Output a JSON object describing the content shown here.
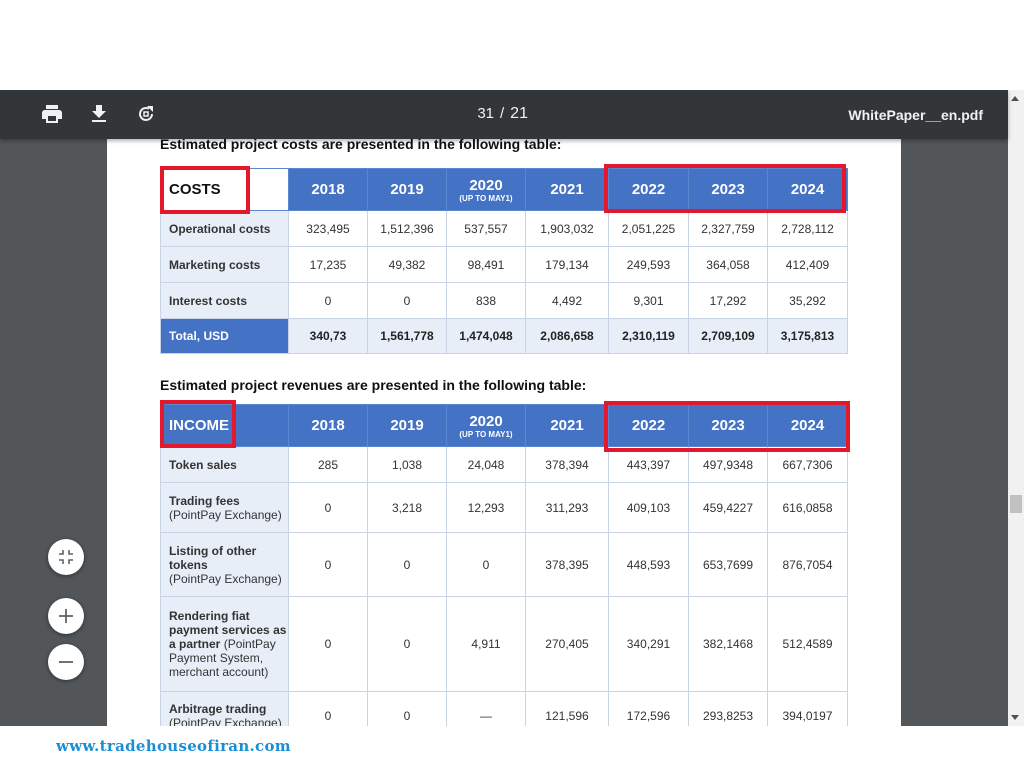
{
  "toolbar": {
    "print_icon": "print-icon",
    "download_icon": "download-icon",
    "rotate_icon": "rotate-icon",
    "page_current": "31",
    "page_separator": "/",
    "page_total": "21",
    "filename": "WhitePaper__en.pdf"
  },
  "costs": {
    "heading": "Estimated project costs are presented in the following table:",
    "header_label": "COSTS",
    "years": [
      "2018",
      "2019",
      "2020",
      "2021",
      "2022",
      "2023",
      "2024"
    ],
    "year_2020_note": "(UP TO MAY1)",
    "rows": [
      {
        "label": "Operational costs",
        "values": [
          "323,495",
          "1,512,396",
          "537,557",
          "1,903,032",
          "2,051,225",
          "2,327,759",
          "2,728,112"
        ]
      },
      {
        "label": "Marketing costs",
        "values": [
          "17,235",
          "49,382",
          "98,491",
          "179,134",
          "249,593",
          "364,058",
          "412,409"
        ]
      },
      {
        "label": "Interest costs",
        "values": [
          "0",
          "0",
          "838",
          "4,492",
          "9,301",
          "17,292",
          "35,292"
        ]
      }
    ],
    "total": {
      "label": "Total, USD",
      "values": [
        "340,73",
        "1,561,778",
        "1,474,048",
        "2,086,658",
        "2,310,119",
        "2,709,109",
        "3,175,813"
      ]
    }
  },
  "income": {
    "heading": "Estimated project revenues are presented in the following table:",
    "header_label": "INCOME",
    "years": [
      "2018",
      "2019",
      "2020",
      "2021",
      "2022",
      "2023",
      "2024"
    ],
    "year_2020_note": "(UP TO MAY1)",
    "rows": [
      {
        "label": "Token sales",
        "label_extra": "",
        "values": [
          "285",
          "1,038",
          "24,048",
          "378,394",
          "443,397",
          "497,9348",
          "667,7306"
        ]
      },
      {
        "label": "Trading fees",
        "label_extra": "(PointPay Exchange)",
        "values": [
          "0",
          "3,218",
          "12,293",
          "311,293",
          "409,103",
          "459,4227",
          "616,0858"
        ]
      },
      {
        "label": "Listing of other tokens",
        "label_extra": "(PointPay Exchange)",
        "values": [
          "0",
          "0",
          "0",
          "378,395",
          "448,593",
          "653,7699",
          "876,7054"
        ]
      },
      {
        "label": "Rendering fiat payment services as a partner",
        "label_extra": "(PointPay Payment System, merchant account)",
        "values": [
          "0",
          "0",
          "4,911",
          "270,405",
          "340,291",
          "382,1468",
          "512,4589"
        ]
      },
      {
        "label": "Arbitrage trading",
        "label_extra": "(PointPay Exchange)",
        "values": [
          "0",
          "0",
          "—",
          "121,596",
          "172,596",
          "293,8253",
          "394,0197"
        ]
      }
    ]
  },
  "controls": {
    "fit_icon": "fit-to-page-icon",
    "zoom_in_icon": "zoom-in-icon",
    "zoom_out_icon": "zoom-out-icon"
  },
  "watermark": "www.tradehouseofiran.com"
}
